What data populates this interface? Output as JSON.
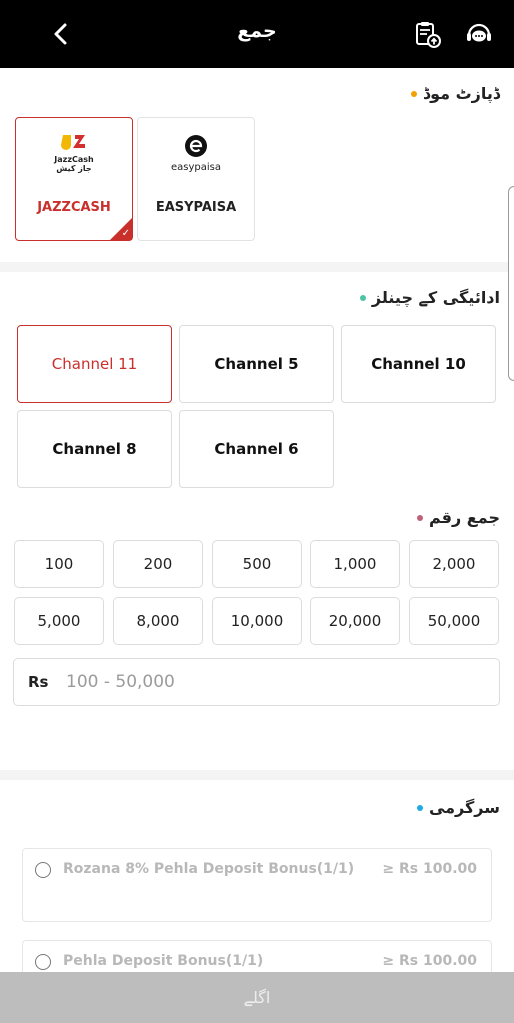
{
  "header": {
    "title": "جمع"
  },
  "deposit_mode": {
    "heading": "ڈپازٹ موڈ",
    "dot_color": "#f2a100",
    "options": [
      {
        "name": "JAZZCASH",
        "logo_text_1": "JazzCash",
        "logo_text_2": "جاز کیش",
        "selected": true
      },
      {
        "name": "EASYPAISA",
        "logo_text_1": "easypaisa",
        "selected": false
      }
    ]
  },
  "channels": {
    "heading": "ادائیگی کے چینلز",
    "dot_color": "#4cc3a5",
    "items": [
      {
        "label": "Channel 11",
        "selected": true
      },
      {
        "label": "Channel 5",
        "selected": false
      },
      {
        "label": "Channel 10",
        "selected": false
      },
      {
        "label": "Channel 8",
        "selected": false
      },
      {
        "label": "Channel 6",
        "selected": false
      }
    ]
  },
  "amount": {
    "heading": "جمع رقم",
    "dot_color": "#c0607a",
    "presets": [
      "100",
      "200",
      "500",
      "1,000",
      "2,000",
      "5,000",
      "8,000",
      "10,000",
      "20,000",
      "50,000"
    ],
    "currency": "Rs",
    "placeholder": "100 - 50,000",
    "value": ""
  },
  "activity": {
    "heading": "سرگرمی",
    "dot_color": "#1fa9e6",
    "bonuses": [
      {
        "name": "Rozana 8% Pehla Deposit Bonus(1/1)",
        "min": "≥ Rs 100.00"
      },
      {
        "name": "Pehla Deposit Bonus(1/1)",
        "min": "≥ Rs 100.00"
      }
    ]
  },
  "footer": {
    "next_label": "اگلے"
  },
  "colors": {
    "accent": "#c9302c",
    "header_bg": "#000000"
  }
}
